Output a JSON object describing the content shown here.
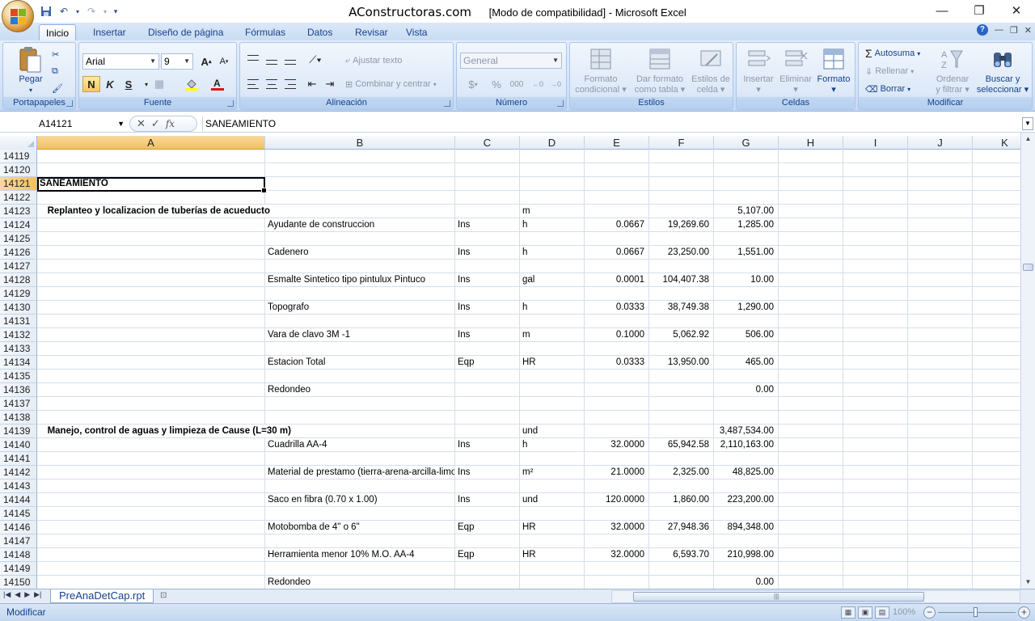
{
  "window": {
    "site": "AConstructoras.com",
    "title": "[Modo de compatibilidad] - Microsoft Excel",
    "minimize": "—",
    "restore": "❐",
    "close": "✕"
  },
  "tabs": [
    "Inicio",
    "Insertar",
    "Diseño de página",
    "Fórmulas",
    "Datos",
    "Revisar",
    "Vista"
  ],
  "ribbon": {
    "clipboard": {
      "label": "Portapapeles",
      "paste": "Pegar"
    },
    "font": {
      "label": "Fuente",
      "name": "Arial",
      "size": "9",
      "bold": "N",
      "italic": "K",
      "underline": "S",
      "grow": "A",
      "shrink": "A"
    },
    "alignment": {
      "label": "Alineación",
      "wrap": "Ajustar texto",
      "merge": "Combinar y centrar"
    },
    "number": {
      "label": "Número",
      "format": "General",
      "currency": "$",
      "percent": "%",
      "thousands": "000"
    },
    "styles": {
      "label": "Estilos",
      "conditional": [
        "Formato",
        "condicional"
      ],
      "as_table": [
        "Dar formato",
        "como tabla"
      ],
      "cell_styles": [
        "Estilos de",
        "celda"
      ]
    },
    "cells": {
      "label": "Celdas",
      "insert": "Insertar",
      "delete": "Eliminar",
      "format": "Formato"
    },
    "editing": {
      "label": "Modificar",
      "autosum": "Autosuma",
      "fill": "Rellenar",
      "clear": "Borrar",
      "sort": [
        "Ordenar",
        "y filtrar"
      ],
      "find": [
        "Buscar y",
        "seleccionar"
      ]
    }
  },
  "formula_bar": {
    "name_box": "A14121",
    "fx": "fx",
    "value": "SANEAMIENTO"
  },
  "columns": [
    "A",
    "B",
    "C",
    "D",
    "E",
    "F",
    "G",
    "H",
    "I",
    "J",
    "K"
  ],
  "rows": [
    {
      "n": "14119",
      "cells": {}
    },
    {
      "n": "14120",
      "cells": {}
    },
    {
      "n": "14121",
      "cells": {
        "A": "SANEAMIENTO"
      }
    },
    {
      "n": "14122",
      "cells": {}
    },
    {
      "n": "14123",
      "cells": {
        "A": "   Replanteo y localizacion de tuberías de acueducto",
        "D": "m",
        "G": "5,107.00"
      }
    },
    {
      "n": "14124",
      "cells": {
        "B": "Ayudante de construccion",
        "C": "Ins",
        "D": "h",
        "E": "0.0667",
        "F": "19,269.60",
        "G": "1,285.00"
      }
    },
    {
      "n": "14125",
      "cells": {}
    },
    {
      "n": "14126",
      "cells": {
        "B": "Cadenero",
        "C": "Ins",
        "D": "h",
        "E": "0.0667",
        "F": "23,250.00",
        "G": "1,551.00"
      }
    },
    {
      "n": "14127",
      "cells": {}
    },
    {
      "n": "14128",
      "cells": {
        "B": "Esmalte Sintetico tipo pintulux Pintuco",
        "C": "Ins",
        "D": "gal",
        "E": "0.0001",
        "F": "104,407.38",
        "G": "10.00"
      }
    },
    {
      "n": "14129",
      "cells": {}
    },
    {
      "n": "14130",
      "cells": {
        "B": "Topografo",
        "C": "Ins",
        "D": "h",
        "E": "0.0333",
        "F": "38,749.38",
        "G": "1,290.00"
      }
    },
    {
      "n": "14131",
      "cells": {}
    },
    {
      "n": "14132",
      "cells": {
        "B": "Vara de clavo 3M -1",
        "C": "Ins",
        "D": "m",
        "E": "0.1000",
        "F": "5,062.92",
        "G": "506.00"
      }
    },
    {
      "n": "14133",
      "cells": {}
    },
    {
      "n": "14134",
      "cells": {
        "B": "Estacion Total",
        "C": "Eqp",
        "D": "HR",
        "E": "0.0333",
        "F": "13,950.00",
        "G": "465.00"
      }
    },
    {
      "n": "14135",
      "cells": {}
    },
    {
      "n": "14136",
      "cells": {
        "B": "Redondeo",
        "G": "0.00"
      }
    },
    {
      "n": "14137",
      "cells": {}
    },
    {
      "n": "14138",
      "cells": {}
    },
    {
      "n": "14139",
      "cells": {
        "A": "   Manejo, control de aguas y limpieza de Cause (L=30 m)",
        "D": "und",
        "G": "3,487,534.00"
      }
    },
    {
      "n": "14140",
      "cells": {
        "B": "Cuadrilla AA-4",
        "C": "Ins",
        "D": "h",
        "E": "32.0000",
        "F": "65,942.58",
        "G": "2,110,163.00"
      }
    },
    {
      "n": "14141",
      "cells": {}
    },
    {
      "n": "14142",
      "cells": {
        "B": "Material de prestamo (tierra-arena-arcilla-limo)",
        "C": "Ins",
        "D": "m²",
        "E": "21.0000",
        "F": "2,325.00",
        "G": "48,825.00"
      }
    },
    {
      "n": "14143",
      "cells": {}
    },
    {
      "n": "14144",
      "cells": {
        "B": "Saco en fibra (0.70 x 1.00)",
        "C": "Ins",
        "D": "und",
        "E": "120.0000",
        "F": "1,860.00",
        "G": "223,200.00"
      }
    },
    {
      "n": "14145",
      "cells": {}
    },
    {
      "n": "14146",
      "cells": {
        "B": "Motobomba de 4\" o 6\"",
        "C": "Eqp",
        "D": "HR",
        "E": "32.0000",
        "F": "27,948.36",
        "G": "894,348.00"
      }
    },
    {
      "n": "14147",
      "cells": {}
    },
    {
      "n": "14148",
      "cells": {
        "B": "Herramienta menor 10% M.O. AA-4",
        "C": "Eqp",
        "D": "HR",
        "E": "32.0000",
        "F": "6,593.70",
        "G": "210,998.00"
      }
    },
    {
      "n": "14149",
      "cells": {}
    },
    {
      "n": "14150",
      "cells": {
        "B": "Redondeo",
        "G": "0.00"
      }
    }
  ],
  "active": {
    "row": "14121",
    "col": "A"
  },
  "sheet_tab": "PreAnaDetCap.rpt",
  "status": {
    "mode": "Modificar",
    "zoom": "100%"
  }
}
